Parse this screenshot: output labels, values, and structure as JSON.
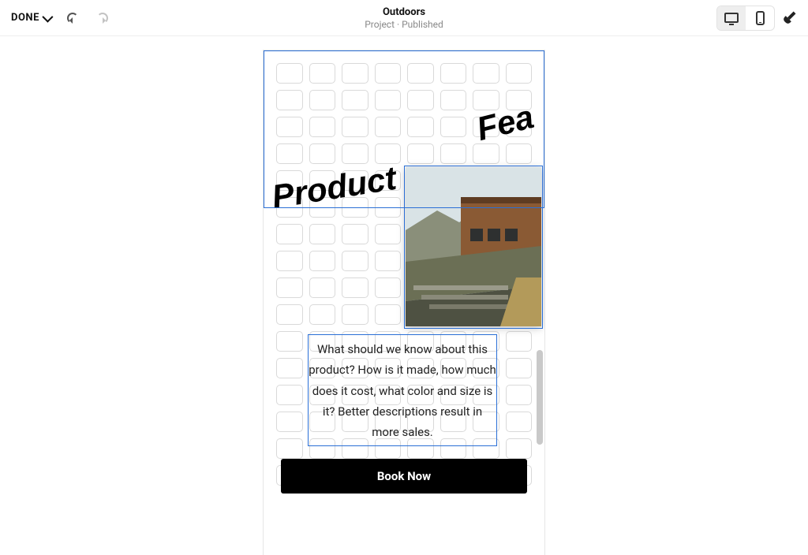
{
  "toolbar": {
    "done_label": "DONE",
    "project_title": "Outdoors",
    "project_subtitle": "Project · Published"
  },
  "canvas": {
    "headline_word1": "Product",
    "headline_word2": "Fea",
    "paragraph_text": "What should we know about this product? How is it made, how much does it cost, what color and size is it? Better descriptions result in more sales.",
    "cta_label": "Book Now"
  }
}
